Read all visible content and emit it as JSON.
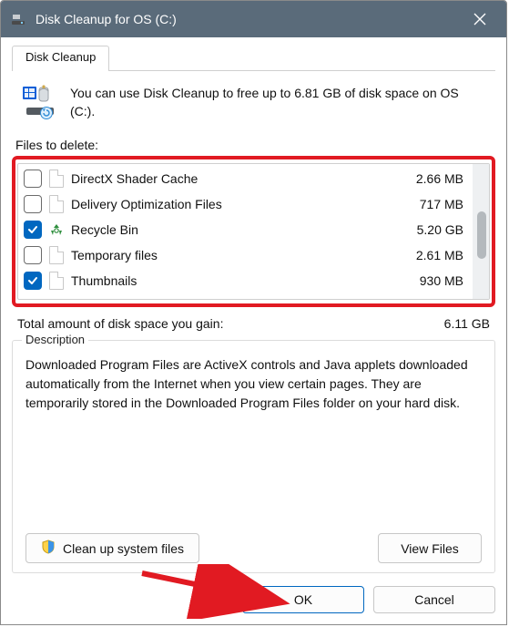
{
  "title": "Disk Cleanup for OS (C:)",
  "tab": {
    "label": "Disk Cleanup"
  },
  "intro": "You can use Disk Cleanup to free up to 6.81 GB of disk space on OS (C:).",
  "files_label": "Files to delete:",
  "files": [
    {
      "name": "DirectX Shader Cache",
      "size": "2.66 MB",
      "checked": false,
      "icon": "doc"
    },
    {
      "name": "Delivery Optimization Files",
      "size": "717 MB",
      "checked": false,
      "icon": "doc"
    },
    {
      "name": "Recycle Bin",
      "size": "5.20 GB",
      "checked": true,
      "icon": "recycle"
    },
    {
      "name": "Temporary files",
      "size": "2.61 MB",
      "checked": false,
      "icon": "doc"
    },
    {
      "name": "Thumbnails",
      "size": "930 MB",
      "checked": true,
      "icon": "doc"
    }
  ],
  "total": {
    "label": "Total amount of disk space you gain:",
    "value": "6.11 GB"
  },
  "description": {
    "heading": "Description",
    "body": "Downloaded Program Files are ActiveX controls and Java applets downloaded automatically from the Internet when you view certain pages. They are temporarily stored in the Downloaded Program Files folder on your hard disk."
  },
  "buttons": {
    "cleanup_system": "Clean up system files",
    "view_files": "View Files",
    "ok": "OK",
    "cancel": "Cancel"
  }
}
